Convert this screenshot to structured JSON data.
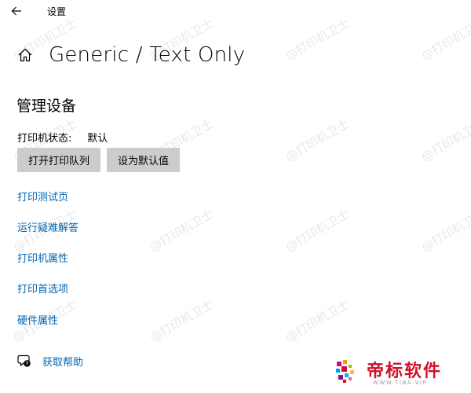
{
  "window": {
    "title": "设置"
  },
  "header": {
    "title": "Generic / Text Only"
  },
  "manage": {
    "section_title": "管理设备",
    "status_label": "打印机状态:",
    "status_value": "默认",
    "open_queue_label": "打开打印队列",
    "set_default_label": "设为默认值"
  },
  "links": [
    {
      "label": "打印测试页"
    },
    {
      "label": "运行疑难解答"
    },
    {
      "label": "打印机属性"
    },
    {
      "label": "打印首选项"
    },
    {
      "label": "硬件属性"
    }
  ],
  "help": {
    "label": "获取帮助"
  },
  "watermark": {
    "text": "@打印机卫士"
  },
  "brand": {
    "name": "帝标软件",
    "subtitle": "WWW.TIBA.VIP"
  },
  "colors": {
    "link": "#0066b4",
    "button_bg": "#cccccc",
    "brand_red": "#d0112b"
  }
}
